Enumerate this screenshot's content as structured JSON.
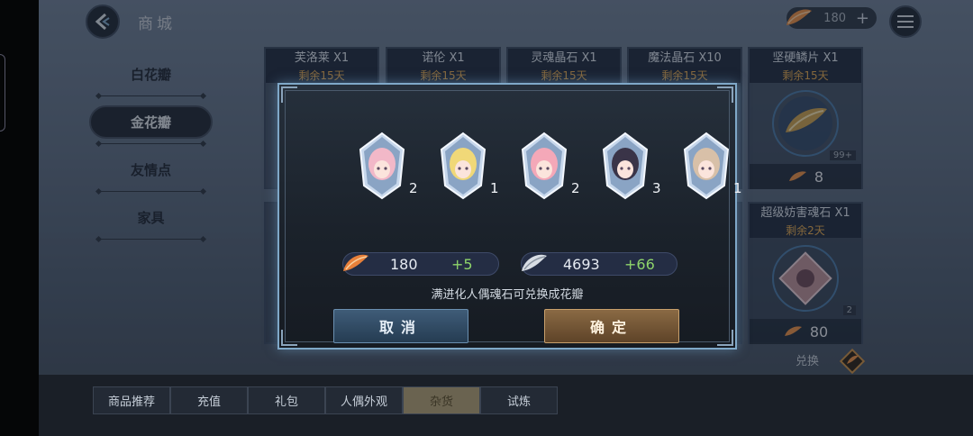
{
  "header": {
    "title": "商城",
    "currency_value": "180"
  },
  "nav": {
    "items": [
      {
        "label": "白花瓣",
        "active": false
      },
      {
        "label": "金花瓣",
        "active": true
      },
      {
        "label": "友情点",
        "active": false
      },
      {
        "label": "家具",
        "active": false
      }
    ]
  },
  "shop": {
    "cards": [
      {
        "name": "芙洛莱 X1",
        "time": "剩余15天"
      },
      {
        "name": "诺伦 X1",
        "time": "剩余15天"
      },
      {
        "name": "灵魂晶石 X1",
        "time": "剩余15天"
      },
      {
        "name": "魔法晶石 X10",
        "time": "剩余15天"
      },
      {
        "name": "坚硬鳞片 X1",
        "time": "剩余15天",
        "badge": "99+",
        "price": "8"
      },
      {
        "name": "超级妨害魂石 X1",
        "time": "剩余2天",
        "badge": "2",
        "price": "80"
      }
    ],
    "exchange_label": "兑换"
  },
  "bottom_tabs": [
    {
      "label": "商品推荐",
      "active": false
    },
    {
      "label": "充值",
      "active": false
    },
    {
      "label": "礼包",
      "active": false
    },
    {
      "label": "人偶外观",
      "active": false
    },
    {
      "label": "杂货",
      "active": true
    },
    {
      "label": "试炼",
      "active": false
    }
  ],
  "modal": {
    "crystals": [
      {
        "count": "2",
        "hair": "#f2b8c8"
      },
      {
        "count": "1",
        "hair": "#f0d878"
      },
      {
        "count": "2",
        "hair": "#f4a8b8"
      },
      {
        "count": "3",
        "hair": "#3a3448"
      },
      {
        "count": "1",
        "hair": "#d8c0a8"
      }
    ],
    "gold_value": "180",
    "gold_increment": "+5",
    "white_value": "4693",
    "white_increment": "+66",
    "hint": "满进化人偶魂石可兑换成花瓣",
    "cancel_label": "取消",
    "confirm_label": "确定"
  },
  "colors": {
    "accent": "#7fa8c8",
    "increment": "#8ed46a",
    "time": "#e0a850"
  }
}
